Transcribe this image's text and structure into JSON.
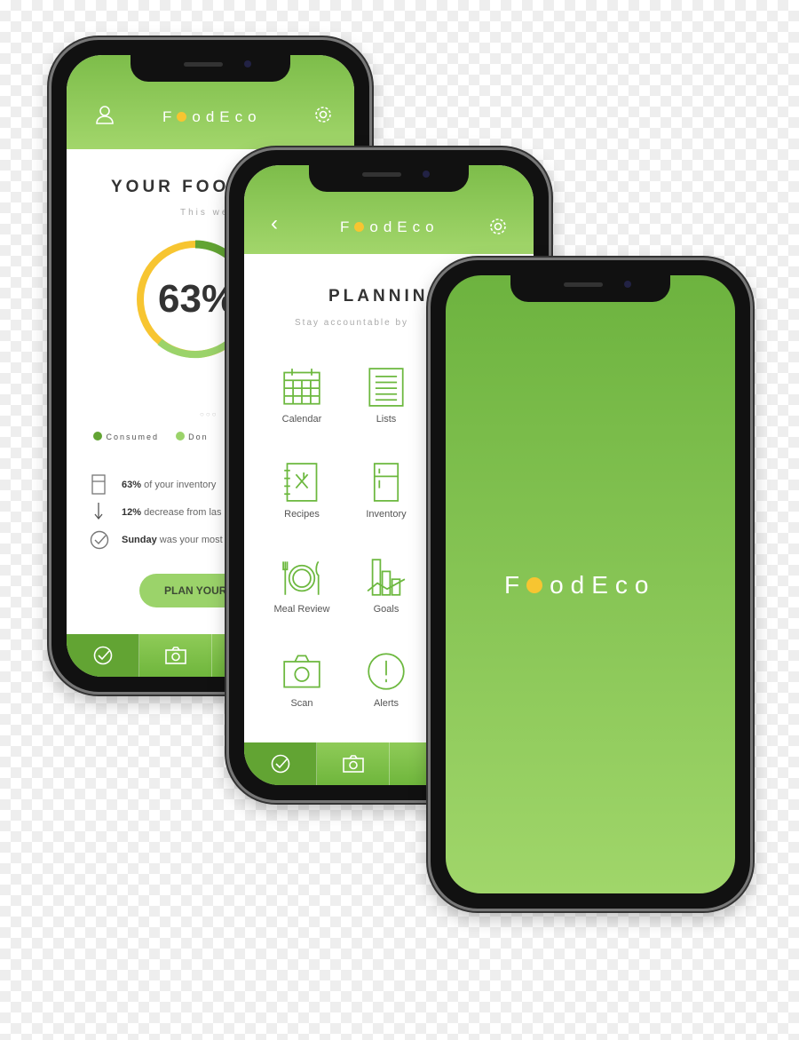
{
  "brand": {
    "name_first": "F",
    "name_rest": "odEco",
    "dot_color": "#f7c531",
    "green": "#7dbd4a"
  },
  "footprint": {
    "title": "YOUR FOOT",
    "subtitle": "This we",
    "percent": "63%",
    "ring": {
      "consumed_fraction": 0.63,
      "colors": {
        "consumed": "#62a433",
        "donated": "#9bd36a",
        "remaining": "#f7c531"
      }
    },
    "legend": [
      "Consumed",
      "Don"
    ],
    "stats": [
      {
        "bold": "63%",
        "text": " of your inventory",
        "icon": "fridge-icon"
      },
      {
        "bold": "12%",
        "text": " decrease from las",
        "icon": "arrow-down-icon"
      },
      {
        "bold": "Sunday",
        "text": " was your most",
        "icon": "check-circle-icon"
      }
    ],
    "button": "PLAN YOUR"
  },
  "planning": {
    "title": "PLANNIN",
    "subtitle": "Stay accountable by",
    "items": [
      {
        "label": "Calendar",
        "icon": "calendar-icon"
      },
      {
        "label": "Lists",
        "icon": "list-icon"
      },
      {
        "label": "Recipes",
        "icon": "recipe-book-icon"
      },
      {
        "label": "Inventory",
        "icon": "fridge-icon"
      },
      {
        "label": "Meal Review",
        "icon": "plate-icon"
      },
      {
        "label": "Goals",
        "icon": "chart-icon"
      },
      {
        "label": "Scan",
        "icon": "camera-icon"
      },
      {
        "label": "Alerts",
        "icon": "alert-icon"
      }
    ]
  },
  "tabs": [
    {
      "icon": "check-circle-icon"
    },
    {
      "icon": "camera-icon"
    },
    {
      "icon": "fridge-icon"
    }
  ]
}
